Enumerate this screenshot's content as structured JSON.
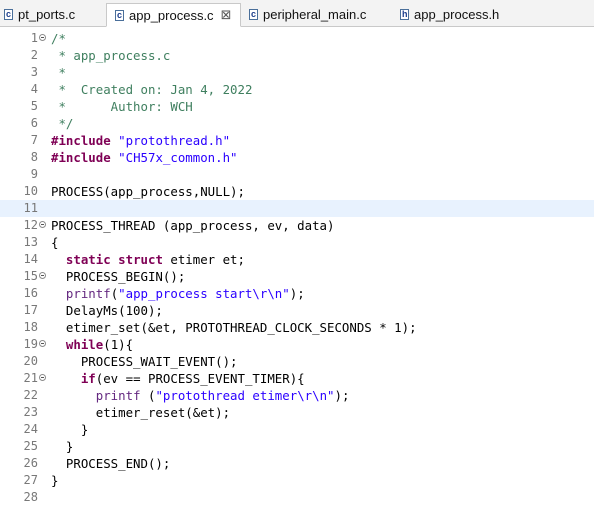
{
  "tabs": [
    {
      "label": "pt_ports.c",
      "icon": "c",
      "active": false
    },
    {
      "label": "app_process.c",
      "icon": "c",
      "active": true,
      "close": "⊠"
    },
    {
      "label": "peripheral_main.c",
      "icon": "c",
      "active": false
    },
    {
      "label": "app_process.h",
      "icon": "h",
      "active": false
    }
  ],
  "editor": {
    "current_line": 11,
    "lines": [
      {
        "n": "1",
        "fold": true,
        "segs": [
          [
            "c",
            "/*"
          ]
        ]
      },
      {
        "n": "2",
        "segs": [
          [
            "c",
            " * app_process.c"
          ]
        ]
      },
      {
        "n": "3",
        "segs": [
          [
            "c",
            " *"
          ]
        ]
      },
      {
        "n": "4",
        "segs": [
          [
            "c",
            " *  Created on: Jan 4, 2022"
          ]
        ]
      },
      {
        "n": "5",
        "segs": [
          [
            "c",
            " *      Author: WCH"
          ]
        ]
      },
      {
        "n": "6",
        "segs": [
          [
            "c",
            " */"
          ]
        ]
      },
      {
        "n": "7",
        "segs": [
          [
            "k",
            "#include"
          ],
          [
            "f",
            " "
          ],
          [
            "s",
            "\"protothread.h\""
          ]
        ]
      },
      {
        "n": "8",
        "segs": [
          [
            "k",
            "#include"
          ],
          [
            "f",
            " "
          ],
          [
            "s",
            "\"CH57x_common.h\""
          ]
        ]
      },
      {
        "n": "9",
        "segs": []
      },
      {
        "n": "10",
        "segs": [
          [
            "f",
            "PROCESS(app_process,NULL);"
          ]
        ]
      },
      {
        "n": "11",
        "segs": []
      },
      {
        "n": "12",
        "fold": true,
        "segs": [
          [
            "f",
            "PROCESS_THREAD (app_process, ev, data)"
          ]
        ]
      },
      {
        "n": "13",
        "segs": [
          [
            "f",
            "{"
          ]
        ]
      },
      {
        "n": "14",
        "segs": [
          [
            "f",
            "  "
          ],
          [
            "k",
            "static"
          ],
          [
            "f",
            " "
          ],
          [
            "k",
            "struct"
          ],
          [
            "f",
            " etimer et;"
          ]
        ]
      },
      {
        "n": "15",
        "fold": true,
        "segs": [
          [
            "f",
            "  PROCESS_BEGIN();"
          ]
        ]
      },
      {
        "n": "16",
        "segs": [
          [
            "f",
            "  "
          ],
          [
            "m",
            "printf"
          ],
          [
            "f",
            "("
          ],
          [
            "s",
            "\"app_process start\\r\\n\""
          ],
          [
            "f",
            ");"
          ]
        ]
      },
      {
        "n": "17",
        "segs": [
          [
            "f",
            "  DelayMs(100);"
          ]
        ]
      },
      {
        "n": "18",
        "segs": [
          [
            "f",
            "  etimer_set(&et, PROTOTHREAD_CLOCK_SECONDS * 1);"
          ]
        ]
      },
      {
        "n": "19",
        "fold": true,
        "segs": [
          [
            "f",
            "  "
          ],
          [
            "k",
            "while"
          ],
          [
            "f",
            "(1){"
          ]
        ]
      },
      {
        "n": "20",
        "segs": [
          [
            "f",
            "    PROCESS_WAIT_EVENT();"
          ]
        ]
      },
      {
        "n": "21",
        "fold": true,
        "segs": [
          [
            "f",
            "    "
          ],
          [
            "k",
            "if"
          ],
          [
            "f",
            "(ev == PROCESS_EVENT_TIMER){"
          ]
        ]
      },
      {
        "n": "22",
        "segs": [
          [
            "f",
            "      "
          ],
          [
            "m",
            "printf"
          ],
          [
            "f",
            " ("
          ],
          [
            "s",
            "\"protothread etimer\\r\\n\""
          ],
          [
            "f",
            ");"
          ]
        ]
      },
      {
        "n": "23",
        "segs": [
          [
            "f",
            "      etimer_reset(&et);"
          ]
        ]
      },
      {
        "n": "24",
        "segs": [
          [
            "f",
            "    }"
          ]
        ]
      },
      {
        "n": "25",
        "segs": [
          [
            "f",
            "  }"
          ]
        ]
      },
      {
        "n": "26",
        "segs": [
          [
            "f",
            "  PROCESS_END();"
          ]
        ]
      },
      {
        "n": "27",
        "segs": [
          [
            "f",
            "}"
          ]
        ]
      },
      {
        "n": "28",
        "segs": []
      }
    ]
  }
}
